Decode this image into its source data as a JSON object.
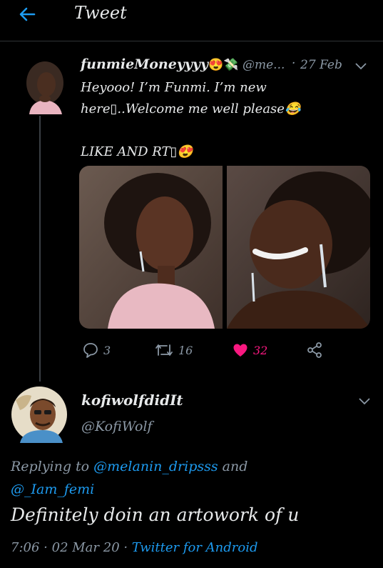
{
  "header": {
    "title": "Tweet"
  },
  "tweet": {
    "author_name": "funmieMoneyyyy",
    "author_emoji": "😍💸",
    "handle": "@me...",
    "separator": "·",
    "date": "27 Feb",
    "text": "Heyooo! I’m Funmi. I’m new here▯..Welcome me well please😂\n\nLIKE AND RT▯😍",
    "actions": {
      "replies": "3",
      "retweets": "16",
      "likes": "32"
    }
  },
  "reply": {
    "author_name": "kofiwolfdidIt",
    "handle": "@KofiWolf",
    "replying_prefix": "Replying to ",
    "mention_1": "@melanin_dripsss",
    "connector": " and",
    "mention_2": "@_Iam_femi",
    "text": "Definitely doin an artowork of u",
    "time": "7:06",
    "separator": "·",
    "date": "02 Mar 20",
    "separator2": "·",
    "source": "Twitter for Android"
  },
  "icons": {
    "back": "arrow-left-icon",
    "more": "chevron-down-icon",
    "reply": "comment-icon",
    "retweet": "retweet-icon",
    "like": "heart-icon",
    "share": "share-icon"
  },
  "colors": {
    "accent": "#1d9bf0",
    "like": "#f91880",
    "muted": "#8b98a5",
    "background": "#000000"
  }
}
